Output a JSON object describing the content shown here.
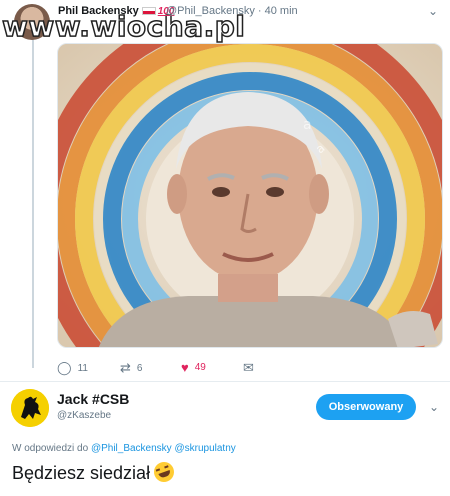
{
  "watermark": "www.wiocha.pl",
  "tweet": {
    "author_name": "Phil Backensky",
    "author_badge": "100",
    "author_handle": "@Phil_Backensky",
    "time": "40 min",
    "image_watermark": "alamy",
    "actions": {
      "replies": "11",
      "retweets": "6",
      "likes": "49"
    }
  },
  "reply": {
    "author_name": "Jack #CSB",
    "author_handle": "@zKaszebe",
    "follow_label": "Obserwowany",
    "reply_to_prefix": "W odpowiedzi do",
    "mention_1": "@Phil_Backensky",
    "mention_2": "@skrupulatny",
    "text": "Będziesz siedział"
  },
  "colors": {
    "accent": "#1da1f2",
    "like": "#e0245e",
    "muted": "#657786"
  },
  "icons": {
    "reply": "reply-icon",
    "retweet": "retweet-icon",
    "like": "heart-icon",
    "dm": "envelope-icon",
    "caret": "chevron-down-icon"
  }
}
